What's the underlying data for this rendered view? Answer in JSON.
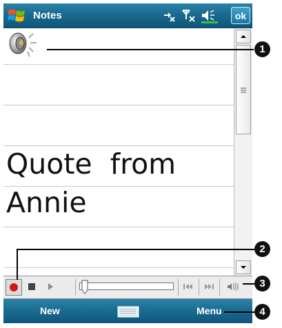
{
  "titlebar": {
    "app_title": "Notes",
    "ok_label": "ok",
    "icons": [
      "windows-start-icon",
      "connectivity-icon",
      "signal-off-icon",
      "volume-icon"
    ]
  },
  "note": {
    "line1": "Quote  from",
    "line2": "Annie",
    "embedded_recording_icon": "speaker-icon"
  },
  "recording_toolbar": {
    "buttons": [
      "record",
      "stop",
      "play",
      "skip-back",
      "skip-forward",
      "volume"
    ],
    "position_fraction": 0.0
  },
  "menubar": {
    "left_label": "New",
    "right_label": "Menu",
    "center_icon": "keyboard-icon"
  },
  "callouts": [
    "1",
    "2",
    "3",
    "4"
  ],
  "colors": {
    "titlebar": "#1a6a8e",
    "record_red": "#d01919",
    "badge": "#111111"
  }
}
